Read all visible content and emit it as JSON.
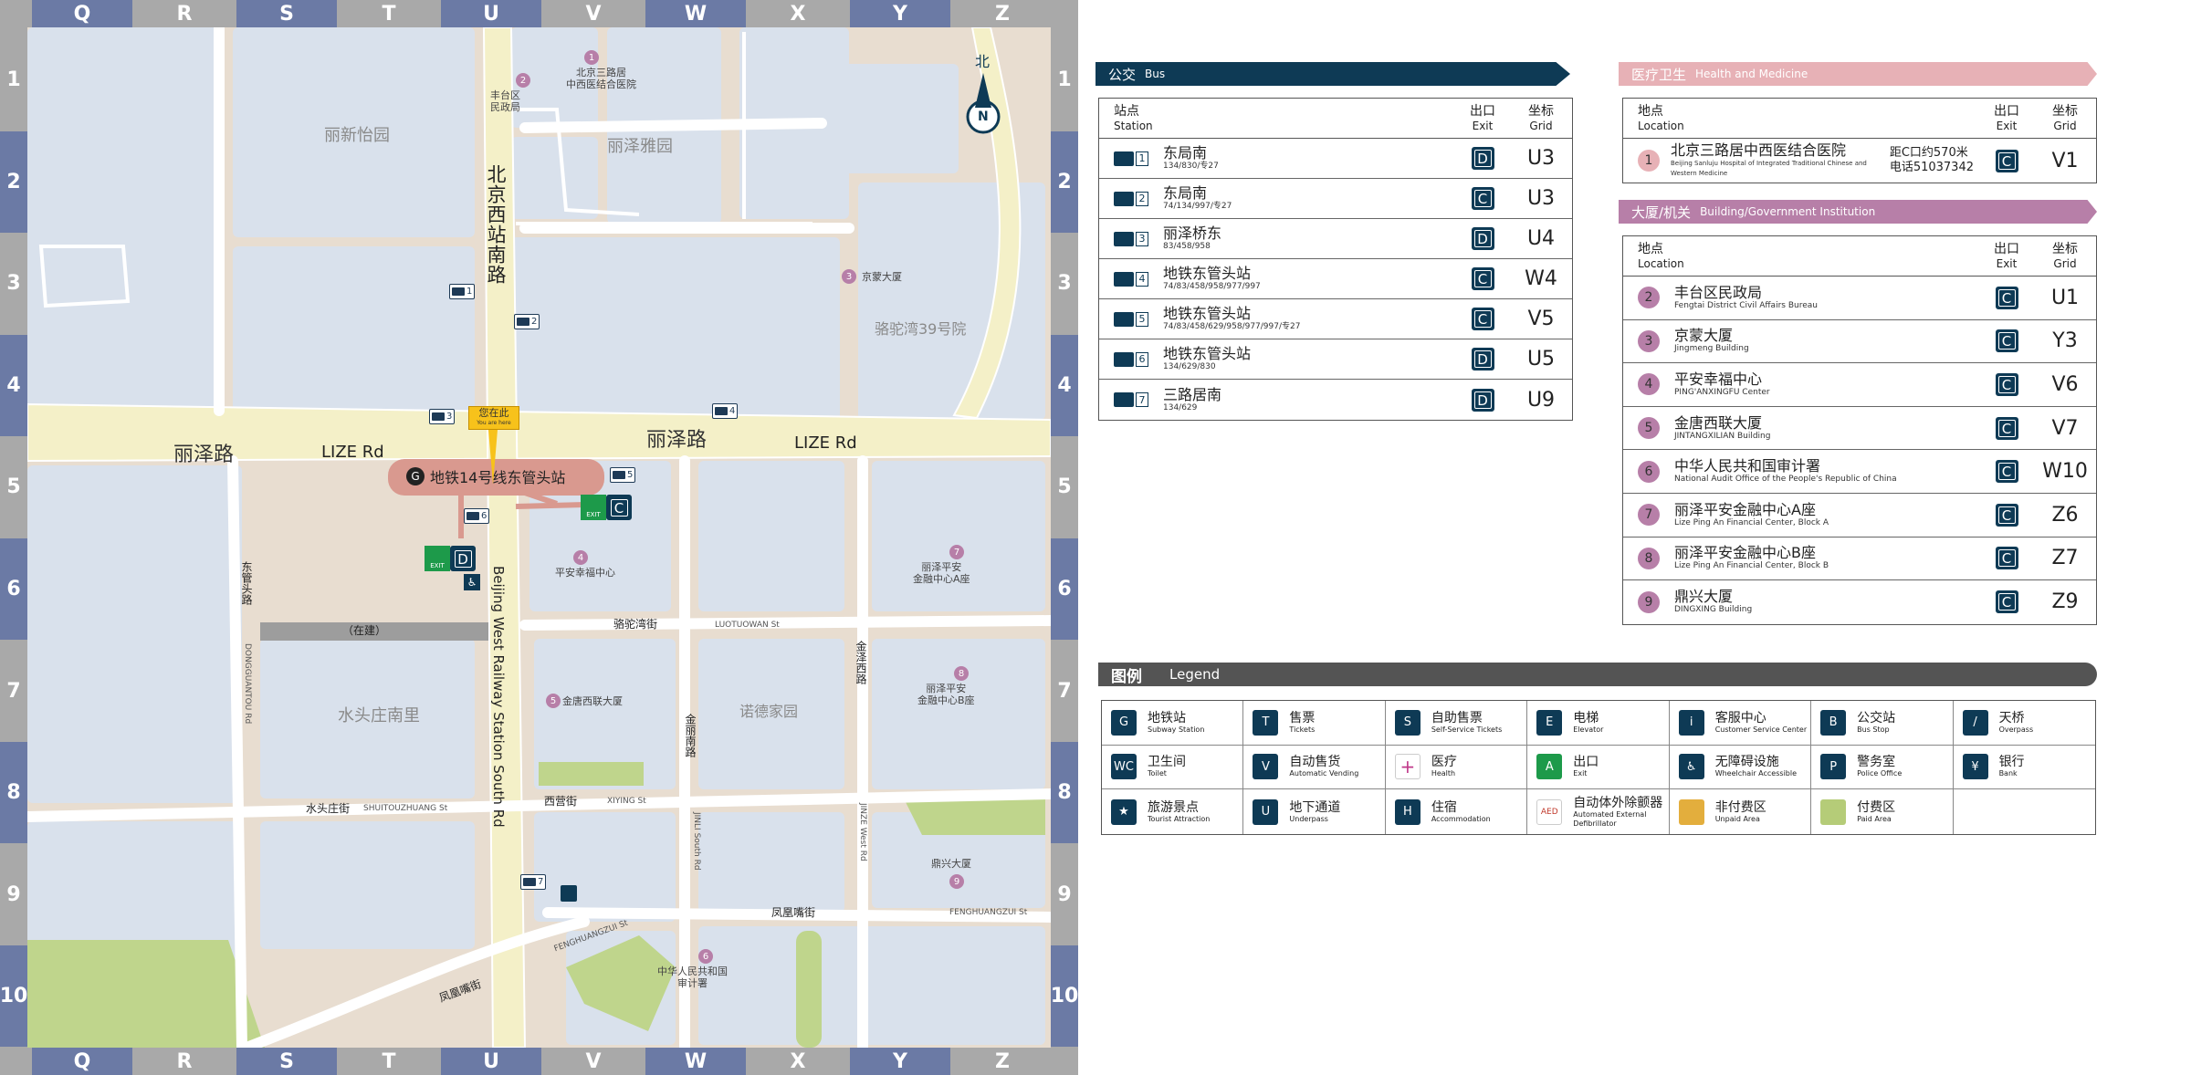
{
  "map": {
    "grid_letters": [
      "Q",
      "R",
      "S",
      "T",
      "U",
      "V",
      "W",
      "X",
      "Y",
      "Z"
    ],
    "grid_numbers": [
      "1",
      "2",
      "3",
      "4",
      "5",
      "6",
      "7",
      "8",
      "9",
      "10"
    ],
    "compass": {
      "label": "北",
      "letter": "N"
    },
    "areas": [
      {
        "id": "lixinyi",
        "text": "丽新怡园"
      },
      {
        "id": "lizeya",
        "text": "丽泽雅园"
      },
      {
        "id": "luotuowan39",
        "text": "骆驼湾39号院"
      },
      {
        "id": "shuitouzhuang",
        "text": "水头庄南里"
      },
      {
        "id": "nuodejiayuan",
        "text": "诺德家园"
      },
      {
        "id": "construction",
        "text": "（在建）"
      }
    ],
    "roads": [
      {
        "id": "lize-zh-left",
        "text": "丽泽路"
      },
      {
        "id": "lize-en-left",
        "text": "LIZE Rd"
      },
      {
        "id": "lize-zh-right",
        "text": "丽泽路"
      },
      {
        "id": "lize-en-right",
        "text": "LIZE Rd"
      },
      {
        "id": "bjxz-zh",
        "text": "北京西站南路"
      },
      {
        "id": "bjxz-en",
        "text": "Beijing West Railway Station South Rd"
      },
      {
        "id": "luotuowan-zh",
        "text": "骆驼湾街"
      },
      {
        "id": "luotuowan-en",
        "text": "LUOTUOWAN St"
      },
      {
        "id": "xiying-zh",
        "text": "西营街"
      },
      {
        "id": "xiying-en",
        "text": "XIYING St"
      },
      {
        "id": "shuitouzhuang-zh",
        "text": "水头庄街"
      },
      {
        "id": "shuitouzhuang-en",
        "text": "SHUITOUZHUANG St"
      },
      {
        "id": "fenghuangzui-zh",
        "text": "凤凰嘴街"
      },
      {
        "id": "fenghuangzui-en",
        "text": "FENGHUANGZUI St"
      },
      {
        "id": "fenghuangzui2-en",
        "text": "FENGHUANGZUI St"
      },
      {
        "id": "fenghuangzui2-zh",
        "text": "凤凰嘴街"
      },
      {
        "id": "jinli-zh",
        "text": "金丽南路"
      },
      {
        "id": "jinli-en",
        "text": "JINLI South Rd"
      },
      {
        "id": "jinze-zh",
        "text": "金泽西路"
      },
      {
        "id": "jinze-en",
        "text": "JINZE West Rd"
      },
      {
        "id": "dongguantou-zh",
        "text": "东管头路"
      },
      {
        "id": "dongguantou-en",
        "text": "DONGGUANTOU Rd"
      }
    ],
    "station_label": "地铁14号线东管头站",
    "exit_c": "C",
    "exit_d": "D",
    "exit_word": "EXIT",
    "you_are_here": "您在此",
    "you_are_here_en": "You are here",
    "poi_labels": [
      {
        "num": "1",
        "text": "北京三路居\n中西医结合医院"
      },
      {
        "num": "2",
        "text": "丰台区\n民政局"
      },
      {
        "num": "3",
        "text": "京蒙大厦"
      },
      {
        "num": "4",
        "text": "平安幸福中心"
      },
      {
        "num": "5",
        "text": "金唐西联大厦"
      },
      {
        "num": "6",
        "text": "中华人民共和国\n审计署"
      },
      {
        "num": "7",
        "text": "丽泽平安\n金融中心A座"
      },
      {
        "num": "8",
        "text": "丽泽平安\n金融中心B座"
      },
      {
        "num": "9",
        "text": "鼎兴大厦"
      }
    ],
    "bus_stops": [
      "1",
      "2",
      "3",
      "4",
      "5",
      "6",
      "7"
    ]
  },
  "bus": {
    "title_zh": "公交",
    "title_en": "Bus",
    "header": {
      "station_zh": "站点",
      "station_en": "Station",
      "exit_zh": "出口",
      "exit_en": "Exit",
      "grid_zh": "坐标",
      "grid_en": "Grid"
    },
    "rows": [
      {
        "num": "1",
        "name": "东局南",
        "lines": "134/830/专27",
        "exit": "D",
        "grid": "U3"
      },
      {
        "num": "2",
        "name": "东局南",
        "lines": "74/134/997/专27",
        "exit": "C",
        "grid": "U3"
      },
      {
        "num": "3",
        "name": "丽泽桥东",
        "lines": "83/458/958",
        "exit": "D",
        "grid": "U4"
      },
      {
        "num": "4",
        "name": "地铁东管头站",
        "lines": "74/83/458/958/977/997",
        "exit": "C",
        "grid": "W4"
      },
      {
        "num": "5",
        "name": "地铁东管头站",
        "lines": "74/83/458/629/958/977/997/专27",
        "exit": "C",
        "grid": "V5"
      },
      {
        "num": "6",
        "name": "地铁东管头站",
        "lines": "134/629/830",
        "exit": "D",
        "grid": "U5"
      },
      {
        "num": "7",
        "name": "三路居南",
        "lines": "134/629",
        "exit": "D",
        "grid": "U9"
      }
    ]
  },
  "health": {
    "title_zh": "医疗卫生",
    "title_en": "Health and Medicine",
    "color": "#e7b1b6",
    "header": {
      "loc_zh": "地点",
      "loc_en": "Location",
      "exit_zh": "出口",
      "exit_en": "Exit",
      "grid_zh": "坐标",
      "grid_en": "Grid"
    },
    "rows": [
      {
        "num": "1",
        "name": "北京三路居中西医结合医院",
        "en": "Beijing Sanluju Hospital of Integrated Traditional Chinese and Western Medicine",
        "note1": "距C口约570米",
        "note2": "电话51037342",
        "exit": "C",
        "grid": "V1"
      }
    ]
  },
  "building": {
    "title_zh": "大厦/机关",
    "title_en": "Building/Government Institution",
    "color": "#b77fa8",
    "header": {
      "loc_zh": "地点",
      "loc_en": "Location",
      "exit_zh": "出口",
      "exit_en": "Exit",
      "grid_zh": "坐标",
      "grid_en": "Grid"
    },
    "rows": [
      {
        "num": "2",
        "name": "丰台区民政局",
        "en": "Fengtai District Civil Affairs Bureau",
        "exit": "C",
        "grid": "U1"
      },
      {
        "num": "3",
        "name": "京蒙大厦",
        "en": "Jingmeng Building",
        "exit": "C",
        "grid": "Y3"
      },
      {
        "num": "4",
        "name": "平安幸福中心",
        "en": "PING'ANXINGFU Center",
        "exit": "C",
        "grid": "V6"
      },
      {
        "num": "5",
        "name": "金唐西联大厦",
        "en": "JINTANGXILIAN Building",
        "exit": "C",
        "grid": "V7"
      },
      {
        "num": "6",
        "name": "中华人民共和国审计署",
        "en": "National Audit Office of the People's Republic of China",
        "exit": "C",
        "grid": "W10"
      },
      {
        "num": "7",
        "name": "丽泽平安金融中心A座",
        "en": "Lize Ping An Financial Center, Block A",
        "exit": "C",
        "grid": "Z6"
      },
      {
        "num": "8",
        "name": "丽泽平安金融中心B座",
        "en": "Lize Ping An Financial Center, Block B",
        "exit": "C",
        "grid": "Z7"
      },
      {
        "num": "9",
        "name": "鼎兴大厦",
        "en": "DINGXING Building",
        "exit": "C",
        "grid": "Z9"
      }
    ]
  },
  "legend": {
    "title_zh": "图例",
    "title_en": "Legend",
    "items": [
      {
        "icon": "subway-icon",
        "zh": "地铁站",
        "en": "Subway Station",
        "glyph": "G"
      },
      {
        "icon": "ticket-icon",
        "zh": "售票",
        "en": "Tickets",
        "glyph": "T"
      },
      {
        "icon": "self-ticket-icon",
        "zh": "自助售票",
        "en": "Self-Service Tickets",
        "glyph": "S"
      },
      {
        "icon": "elevator-icon",
        "zh": "电梯",
        "en": "Elevator",
        "glyph": "E"
      },
      {
        "icon": "customer-service-icon",
        "zh": "客服中心",
        "en": "Customer Service Center",
        "glyph": "i"
      },
      {
        "icon": "bus-stop-icon",
        "zh": "公交站",
        "en": "Bus Stop",
        "glyph": "B"
      },
      {
        "icon": "overpass-icon",
        "zh": "天桥",
        "en": "Overpass",
        "glyph": "/"
      },
      {
        "icon": "toilet-icon",
        "zh": "卫生间",
        "en": "Toilet",
        "glyph": "WC"
      },
      {
        "icon": "vending-icon",
        "zh": "自动售货",
        "en": "Automatic Vending",
        "glyph": "V"
      },
      {
        "icon": "health-icon",
        "zh": "医疗",
        "en": "Health",
        "glyph": "+"
      },
      {
        "icon": "exit-icon",
        "zh": "出口",
        "en": "Exit",
        "glyph": "A"
      },
      {
        "icon": "wheelchair-icon",
        "zh": "无障碍设施",
        "en": "Wheelchair Accessible",
        "glyph": "♿"
      },
      {
        "icon": "police-icon",
        "zh": "警务室",
        "en": "Police Office",
        "glyph": "P"
      },
      {
        "icon": "bank-icon",
        "zh": "银行",
        "en": "Bank",
        "glyph": "¥"
      },
      {
        "icon": "attraction-icon",
        "zh": "旅游景点",
        "en": "Tourist Attraction",
        "glyph": "★"
      },
      {
        "icon": "underpass-icon",
        "zh": "地下通道",
        "en": "Underpass",
        "glyph": "U"
      },
      {
        "icon": "accommodation-icon",
        "zh": "住宿",
        "en": "Accommodation",
        "glyph": "H"
      },
      {
        "icon": "aed-icon",
        "zh": "自动体外除颤器",
        "en": "Automated External Defibrillator",
        "glyph": "AED"
      },
      {
        "icon": "unpaid-area-icon",
        "zh": "非付费区",
        "en": "Unpaid Area",
        "glyph": ""
      },
      {
        "icon": "paid-area-icon",
        "zh": "付费区",
        "en": "Paid Area",
        "glyph": ""
      },
      {
        "icon": "empty-icon",
        "zh": "",
        "en": "",
        "glyph": ""
      }
    ]
  },
  "colors": {
    "navy": "#0e3a55",
    "frame_blue": "#6b7aa5",
    "frame_gray": "#a9a9a9",
    "block_blue": "#d9e1ec",
    "ground": "#e8ddd0",
    "road_yellow": "#f4f0c8",
    "green": "#bfd58c",
    "station_pink": "#d9998f",
    "exit_green": "#1d9a4a",
    "legend_band": "#545454"
  }
}
